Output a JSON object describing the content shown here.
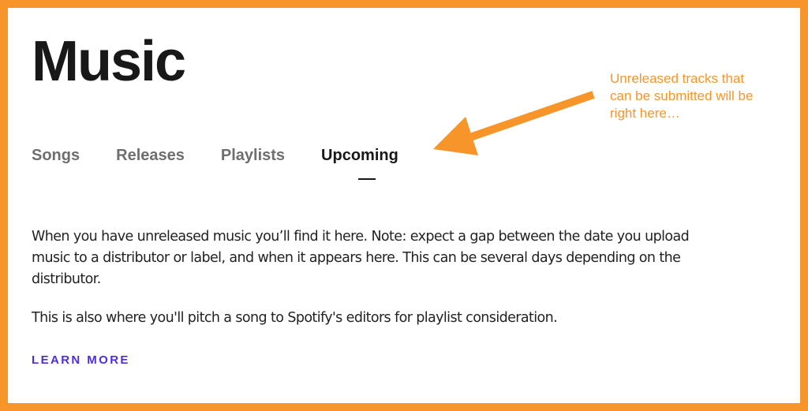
{
  "page": {
    "title": "Music",
    "tabs": [
      {
        "label": "Songs",
        "active": false
      },
      {
        "label": "Releases",
        "active": false
      },
      {
        "label": "Playlists",
        "active": false
      },
      {
        "label": "Upcoming",
        "active": true
      }
    ],
    "paragraphs": [
      "When you have unreleased music you’ll find it here. Note: expect a gap between the date you upload music to a distributor or label, and when it appears here. This can be several days depending on the distributor.",
      "This is also where you'll pitch a song to Spotify's editors for playlist consideration."
    ],
    "learn_more_label": "LEARN MORE"
  },
  "annotation": {
    "lines": [
      "Unreleased tracks that",
      "can be submitted will be",
      "right here…"
    ],
    "color": "#F7952A"
  },
  "colors": {
    "frame": "#F7952A",
    "link": "#4a2fe0",
    "active_tab": "#181818",
    "inactive_tab": "#6e6e6e"
  }
}
